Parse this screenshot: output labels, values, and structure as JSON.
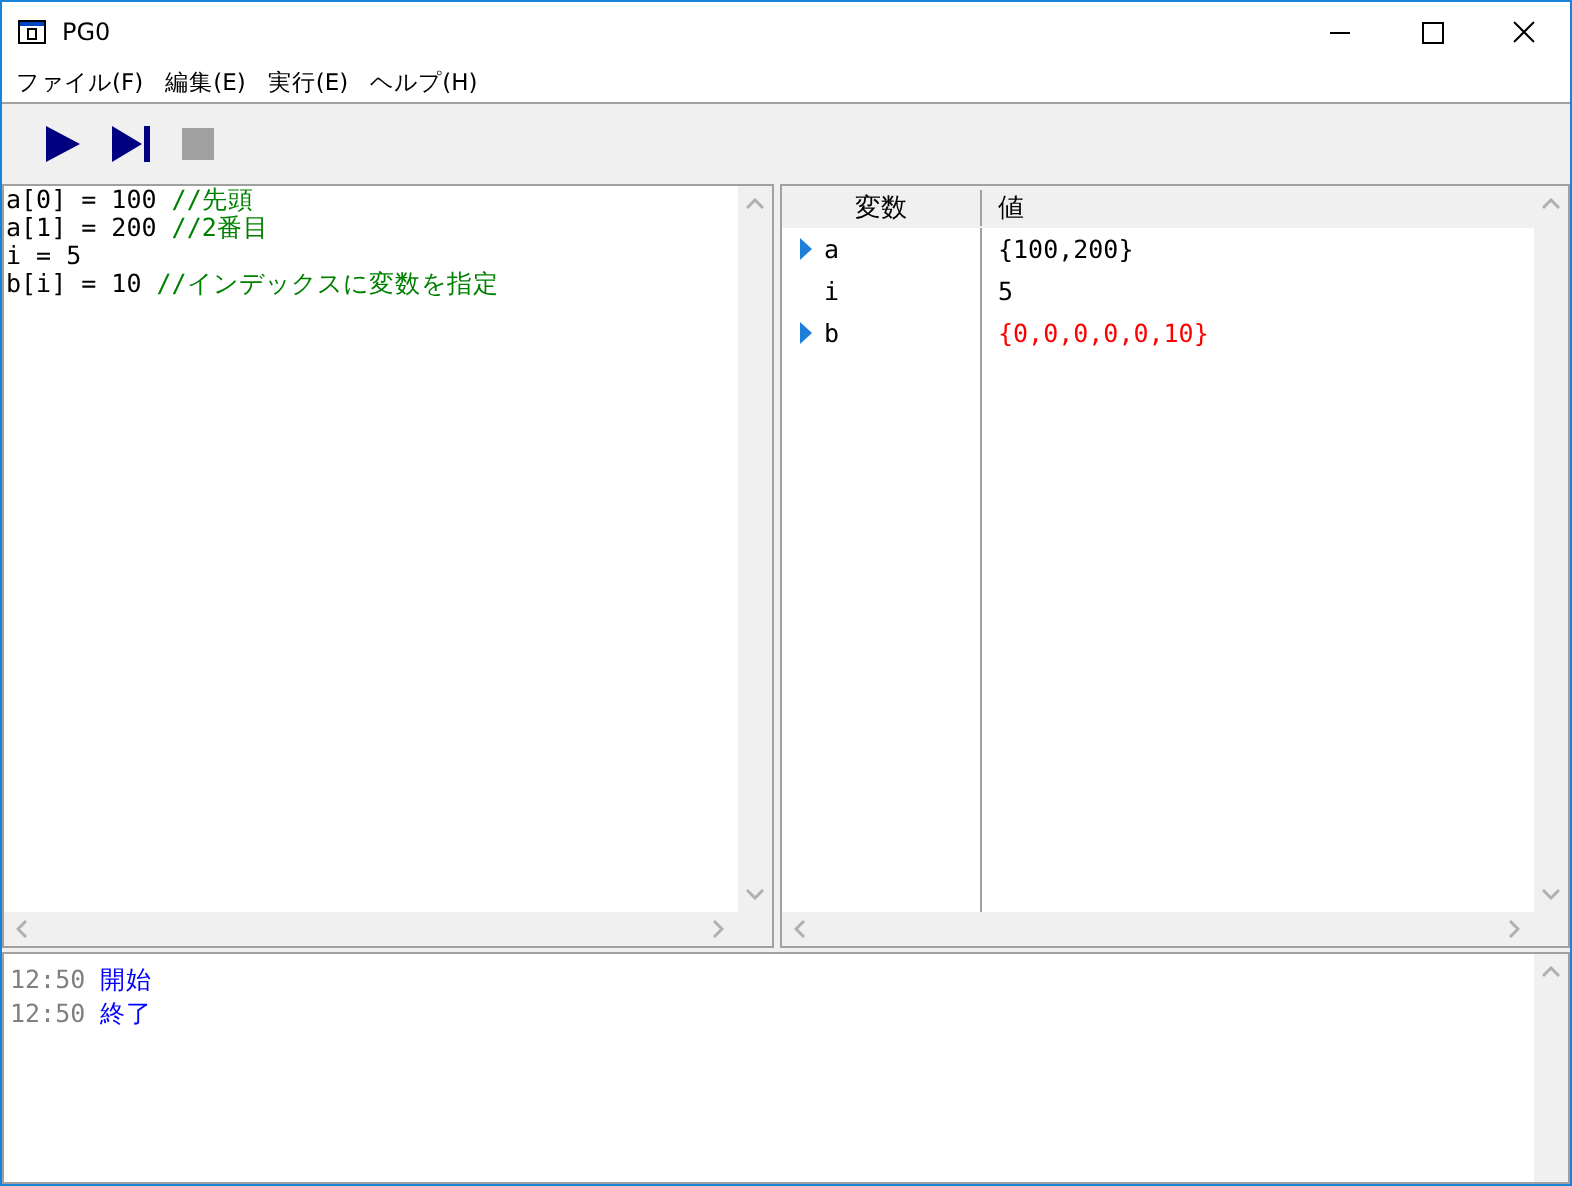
{
  "window": {
    "title": "PG0"
  },
  "menu": [
    "ファイル(F)",
    "編集(E)",
    "実行(E)",
    "ヘルプ(H)"
  ],
  "toolbar": [
    {
      "kind": "run",
      "disabled": false
    },
    {
      "kind": "step",
      "disabled": false
    },
    {
      "kind": "stop",
      "disabled": true
    }
  ],
  "editor": {
    "lines": [
      {
        "code": "a[0] = 100 ",
        "comment": "//先頭"
      },
      {
        "code": "a[1] = 200 ",
        "comment": "//2番目"
      },
      {
        "code": "i = 5"
      },
      {
        "code": "b[i] = 10 ",
        "comment": "//インデックスに変数を指定"
      }
    ]
  },
  "variables": {
    "columns": [
      "変数",
      "値"
    ],
    "rows": [
      {
        "name": "a",
        "value": "{100,200}",
        "expandable": true,
        "changed": false
      },
      {
        "name": "i",
        "value": "5",
        "expandable": false,
        "changed": false
      },
      {
        "name": "b",
        "value": "{0,0,0,0,0,10}",
        "expandable": true,
        "changed": true
      }
    ]
  },
  "log": [
    {
      "time": "12:50",
      "message": "開始"
    },
    {
      "time": "12:50",
      "message": "終了"
    }
  ]
}
